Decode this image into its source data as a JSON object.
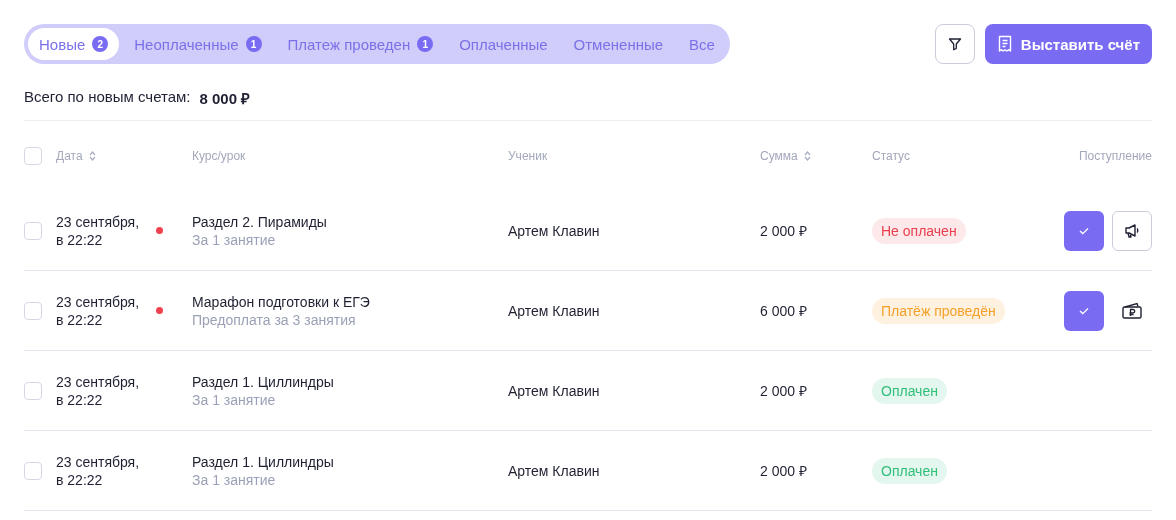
{
  "tabs": [
    {
      "label": "Новые",
      "count": "2",
      "selected": true
    },
    {
      "label": "Неоплаченные",
      "count": "1",
      "selected": false
    },
    {
      "label": "Платеж проведен",
      "count": "1",
      "selected": false
    },
    {
      "label": "Оплаченные",
      "selected": false
    },
    {
      "label": "Отмененные",
      "selected": false
    },
    {
      "label": "Все",
      "selected": false
    }
  ],
  "create_button": "Выставить счёт",
  "total": {
    "label": "Всего по новым счетам:",
    "value": "8 000 ₽"
  },
  "table": {
    "select_all_checked": false,
    "columns": [
      {
        "label": "Дата",
        "sortable": true
      },
      {
        "label": "Курс/урок",
        "sortable": false
      },
      {
        "label": "Ученик",
        "sortable": false
      },
      {
        "label": "Сумма",
        "sortable": true
      },
      {
        "label": "Статус",
        "sortable": false
      },
      {
        "label": "Поступление",
        "sortable": false
      }
    ],
    "rows": [
      {
        "checked": false,
        "date": "23 сентября,",
        "time": "в 22:22",
        "unread": true,
        "course": "Раздел 2. Пирамиды",
        "note": "За 1 занятие",
        "student": "Артем Клавин",
        "sum": "2 000 ₽",
        "status": {
          "kind": "unpaid",
          "label": "Не оплачен"
        },
        "actions": [
          {
            "kind": "confirm"
          },
          {
            "kind": "remind"
          }
        ]
      },
      {
        "checked": false,
        "date": "23 сентября,",
        "time": "в 22:22",
        "unread": true,
        "course": "Марафон подготовки к ЕГЭ",
        "note": "Предоплата за 3 занятия",
        "student": "Артем Клавин",
        "sum": "6 000 ₽",
        "status": {
          "kind": "processed",
          "label": "Платёж проведён"
        },
        "actions": [
          {
            "kind": "confirm"
          },
          {
            "kind": "cash"
          }
        ]
      },
      {
        "checked": false,
        "date": "23 сентября,",
        "time": "в 22:22",
        "unread": false,
        "course": "Раздел 1. Циллиндры",
        "note": "За 1 занятие",
        "student": "Артем Клавин",
        "sum": "2 000 ₽",
        "status": {
          "kind": "paid",
          "label": "Оплачен"
        }
      },
      {
        "checked": false,
        "date": "23 сентября,",
        "time": "в 22:22",
        "unread": false,
        "course": "Раздел 1. Циллиндры",
        "note": "За 1 занятие",
        "student": "Артем Клавин",
        "sum": "2 000 ₽",
        "status": {
          "kind": "paid",
          "label": "Оплачен"
        }
      }
    ]
  }
}
